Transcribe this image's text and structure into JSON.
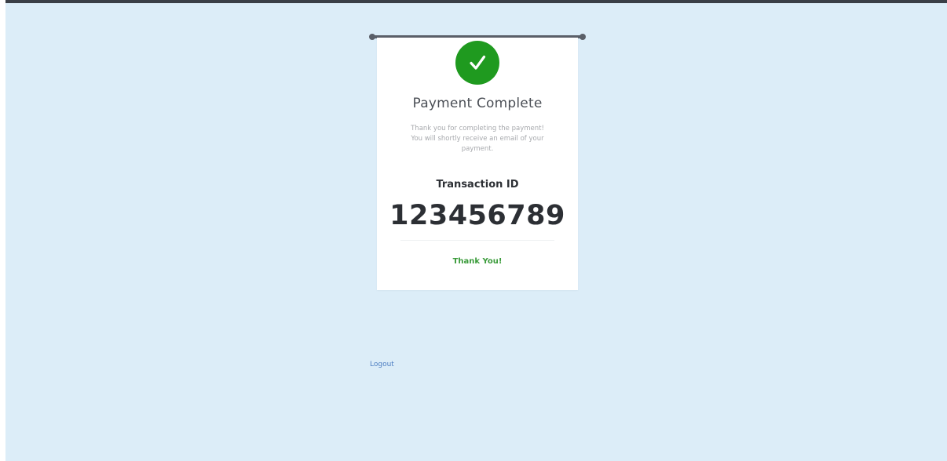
{
  "card": {
    "title": "Payment Complete",
    "message": "Thank you for completing the payment! You will shortly receive an email of your payment.",
    "transaction_label": "Transaction ID",
    "transaction_id": "123456789",
    "thanks": "Thank You!"
  },
  "footer": {
    "logout_label": "Logout"
  },
  "icons": {
    "status": "check-icon"
  },
  "colors": {
    "background": "#dcedf8",
    "success": "#1f9a1f",
    "link": "#4d7ec2"
  }
}
